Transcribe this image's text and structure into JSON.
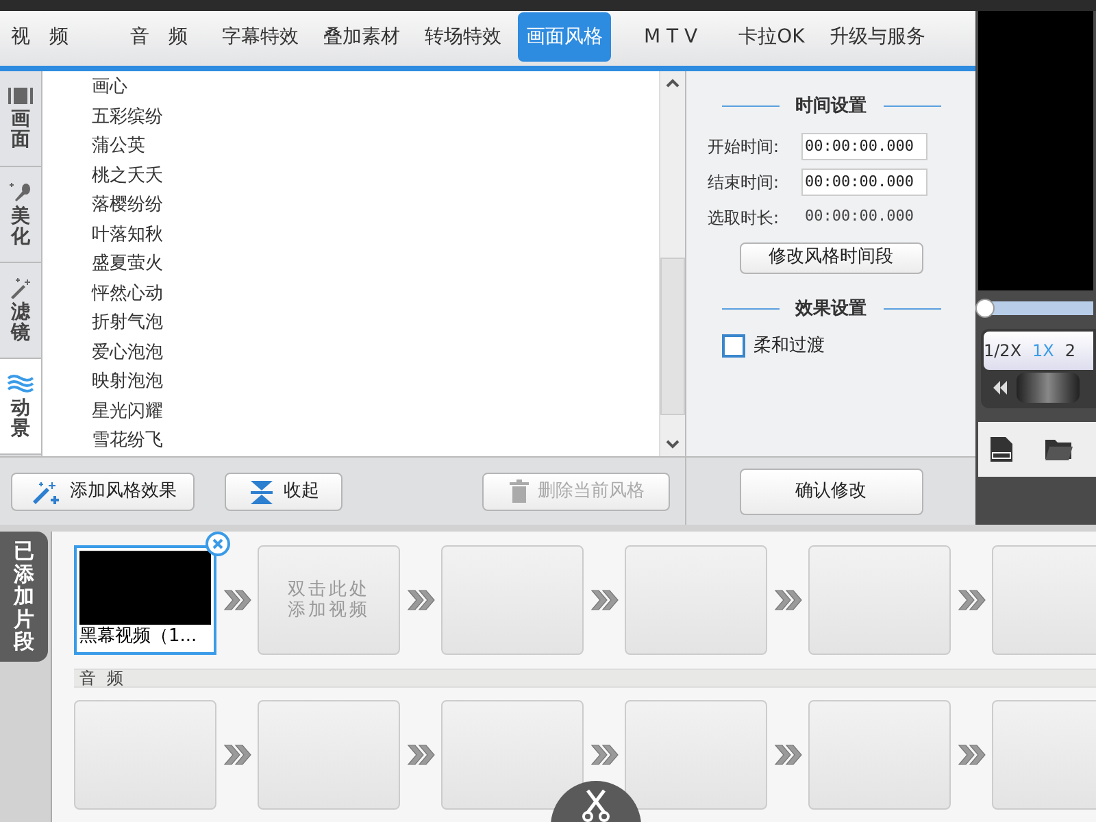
{
  "tabs": [
    {
      "label": "视　频",
      "selected": false
    },
    {
      "label": "音　频",
      "selected": false
    },
    {
      "label": "字幕特效",
      "selected": false
    },
    {
      "label": "叠加素材",
      "selected": false
    },
    {
      "label": "转场特效",
      "selected": false
    },
    {
      "label": "画面风格",
      "selected": true
    },
    {
      "label": "M T V",
      "selected": false
    },
    {
      "label": "卡拉OK",
      "selected": false
    },
    {
      "label": "升级与服务",
      "selected": false
    }
  ],
  "side_tabs": [
    {
      "label": "画面",
      "selected": false
    },
    {
      "label": "美化",
      "selected": false
    },
    {
      "label": "滤镜",
      "selected": false
    },
    {
      "label": "动景",
      "selected": true
    }
  ],
  "effects": [
    "画心",
    "五彩缤纷",
    "蒲公英",
    "桃之夭夭",
    "落樱纷纷",
    "叶落知秋",
    "盛夏萤火",
    "怦然心动",
    "折射气泡",
    "爱心泡泡",
    "映射泡泡",
    "星光闪耀",
    "雪花纷飞"
  ],
  "actions": [
    {
      "label": "添加风格效果",
      "disabled": false
    },
    {
      "label": "收起",
      "disabled": false
    },
    {
      "label": "删除当前风格",
      "disabled": true
    }
  ],
  "time_settings": {
    "title": "时间设置",
    "fields": [
      {
        "kind": "input",
        "label": "开始时间:",
        "value": "00:00:00.000"
      },
      {
        "kind": "input",
        "label": "结束时间:",
        "value": "00:00:00.000"
      },
      {
        "kind": "text",
        "label": "选取时长:",
        "value": "00:00:00.000"
      }
    ],
    "button": "修改风格时间段"
  },
  "effect_settings": {
    "title": "效果设置",
    "option": {
      "label": "柔和过渡",
      "checked": false
    }
  },
  "confirm_button": "确认修改",
  "preview": {
    "progress": {
      "level": 0
    },
    "speeds": [
      {
        "label": "1/2X",
        "selected": false
      },
      {
        "label": "1X",
        "selected": true
      },
      {
        "label": "2",
        "selected": false
      }
    ]
  },
  "timeline": {
    "label": "已添加片段",
    "video_slots": [
      {
        "kind": "clip",
        "caption": "黑幕视频（1...",
        "selected": true
      },
      {
        "kind": "add",
        "lines": [
          "双击此处",
          "添加视频"
        ]
      },
      {
        "kind": "empty"
      },
      {
        "kind": "empty"
      },
      {
        "kind": "empty"
      },
      {
        "kind": "empty"
      }
    ],
    "audio_label": "音 频",
    "audio_slots": [
      {
        "kind": "empty"
      },
      {
        "kind": "empty"
      },
      {
        "kind": "empty"
      },
      {
        "kind": "empty"
      },
      {
        "kind": "empty"
      },
      {
        "kind": "empty"
      }
    ]
  }
}
